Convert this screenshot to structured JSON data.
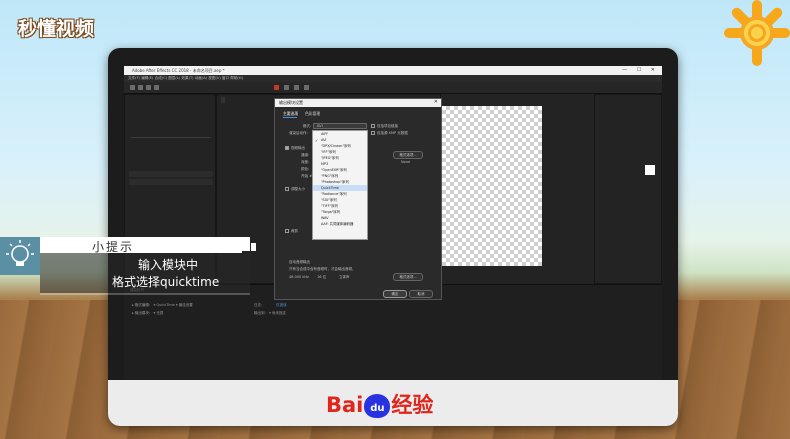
{
  "brand": {
    "logo": "秒懂视频"
  },
  "window": {
    "title": "Adobe After Effects CC 2018 - 未命名项目.aep *",
    "controls": "—  ☐  ✕",
    "menu": "文件(F)  编辑(E)  合成(C)  图层(L)  效果(T)  动画(A)  视图(V)  窗口  帮助(H)"
  },
  "dialog": {
    "title": "输出模块设置",
    "close": "✕",
    "tabs": [
      "主要选项",
      "色彩管理"
    ],
    "format_label": "格式:",
    "format_value": "AVI",
    "post_render_label": "渲染后动作:",
    "include_project_link": "包括项目链接",
    "include_source_xmp": "包括源 XMP 元数据",
    "video_output": "视频输出",
    "channels_label": "通道:",
    "depth_label": "深度:",
    "color_label": "颜色:",
    "start_label": "开始 #:",
    "format_options_btn": "格式选项...",
    "none_text": "None",
    "resize_label": "调整大小",
    "crop_label": "裁剪",
    "audio_output": "自动音频输出",
    "audio_note": "只有当合成中含有音频时，才会输出音频。",
    "audio_rate": "48.000 kHz",
    "audio_bits": "16 位",
    "audio_channels": "立体声",
    "audio_format_btn": "格式选项...",
    "ok": "确定",
    "cancel": "取消"
  },
  "format_list": [
    {
      "label": "AIFF",
      "selected": false,
      "checked": false
    },
    {
      "label": "AVI",
      "selected": false,
      "checked": true
    },
    {
      "label": "\"DPX/Cineon\"序列",
      "selected": false,
      "checked": false
    },
    {
      "label": "\"IFF\"序列",
      "selected": false,
      "checked": false
    },
    {
      "label": "\"JPEG\"序列",
      "selected": false,
      "checked": false
    },
    {
      "label": "MP3",
      "selected": false,
      "checked": false
    },
    {
      "label": "\"OpenEXR\"序列",
      "selected": false,
      "checked": false
    },
    {
      "label": "\"PNG\"序列",
      "selected": false,
      "checked": false
    },
    {
      "label": "\"Photoshop\"序列",
      "selected": false,
      "checked": false
    },
    {
      "label": "QuickTime",
      "selected": true,
      "checked": false
    },
    {
      "label": "\"Radiance\"序列",
      "selected": false,
      "checked": false
    },
    {
      "label": "\"SGI\"序列",
      "selected": false,
      "checked": false
    },
    {
      "label": "\"TIFF\"序列",
      "selected": false,
      "checked": false
    },
    {
      "label": "\"Targa\"序列",
      "selected": false,
      "checked": false
    },
    {
      "label": "WAV",
      "selected": false,
      "checked": false
    },
    {
      "label": "AAF: 共同媒体编码器",
      "selected": false,
      "checked": false
    }
  ],
  "timeline": {
    "tab": "渲染队列",
    "row1": "▸  格式编辑：  ▾ QuickTime ▾ 最佳设置",
    "row2": "▸  输出模块：  ▾ 无损",
    "row2_right": "输出到：  ▾ 尚未指定",
    "log_label": "日志：",
    "log_value": "仅错误"
  },
  "tip": {
    "title": "小提示",
    "line1": "输入模块中",
    "line2": "格式选择quicktime"
  },
  "monitor_brand": {
    "bai": "Bai",
    "du": "du",
    "jingyan": "经验"
  },
  "colors": {
    "sky": "#cfeefb",
    "wood": "#9a6a3c",
    "tip_bg": "#5b8fa3",
    "baidu_red": "#e1251b",
    "baidu_blue": "#2932e1"
  }
}
